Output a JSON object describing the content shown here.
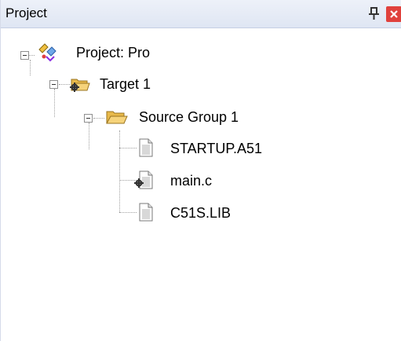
{
  "panel": {
    "title": "Project",
    "pin_icon": "pin-icon",
    "close_icon": "close-icon"
  },
  "tree": {
    "project": {
      "label": "Project: Pro",
      "icon": "project-icon"
    },
    "target": {
      "label": "Target 1",
      "icon": "target-folder-icon"
    },
    "group": {
      "label": "Source Group 1",
      "icon": "folder-icon"
    },
    "files": [
      {
        "label": "STARTUP.A51",
        "icon": "file-icon"
      },
      {
        "label": "main.c",
        "icon": "file-modified-icon"
      },
      {
        "label": "C51S.LIB",
        "icon": "file-icon"
      }
    ]
  },
  "colors": {
    "titlebar": "#e6ebf5",
    "close_button": "#e0413c",
    "folder": "#f2c55c"
  }
}
